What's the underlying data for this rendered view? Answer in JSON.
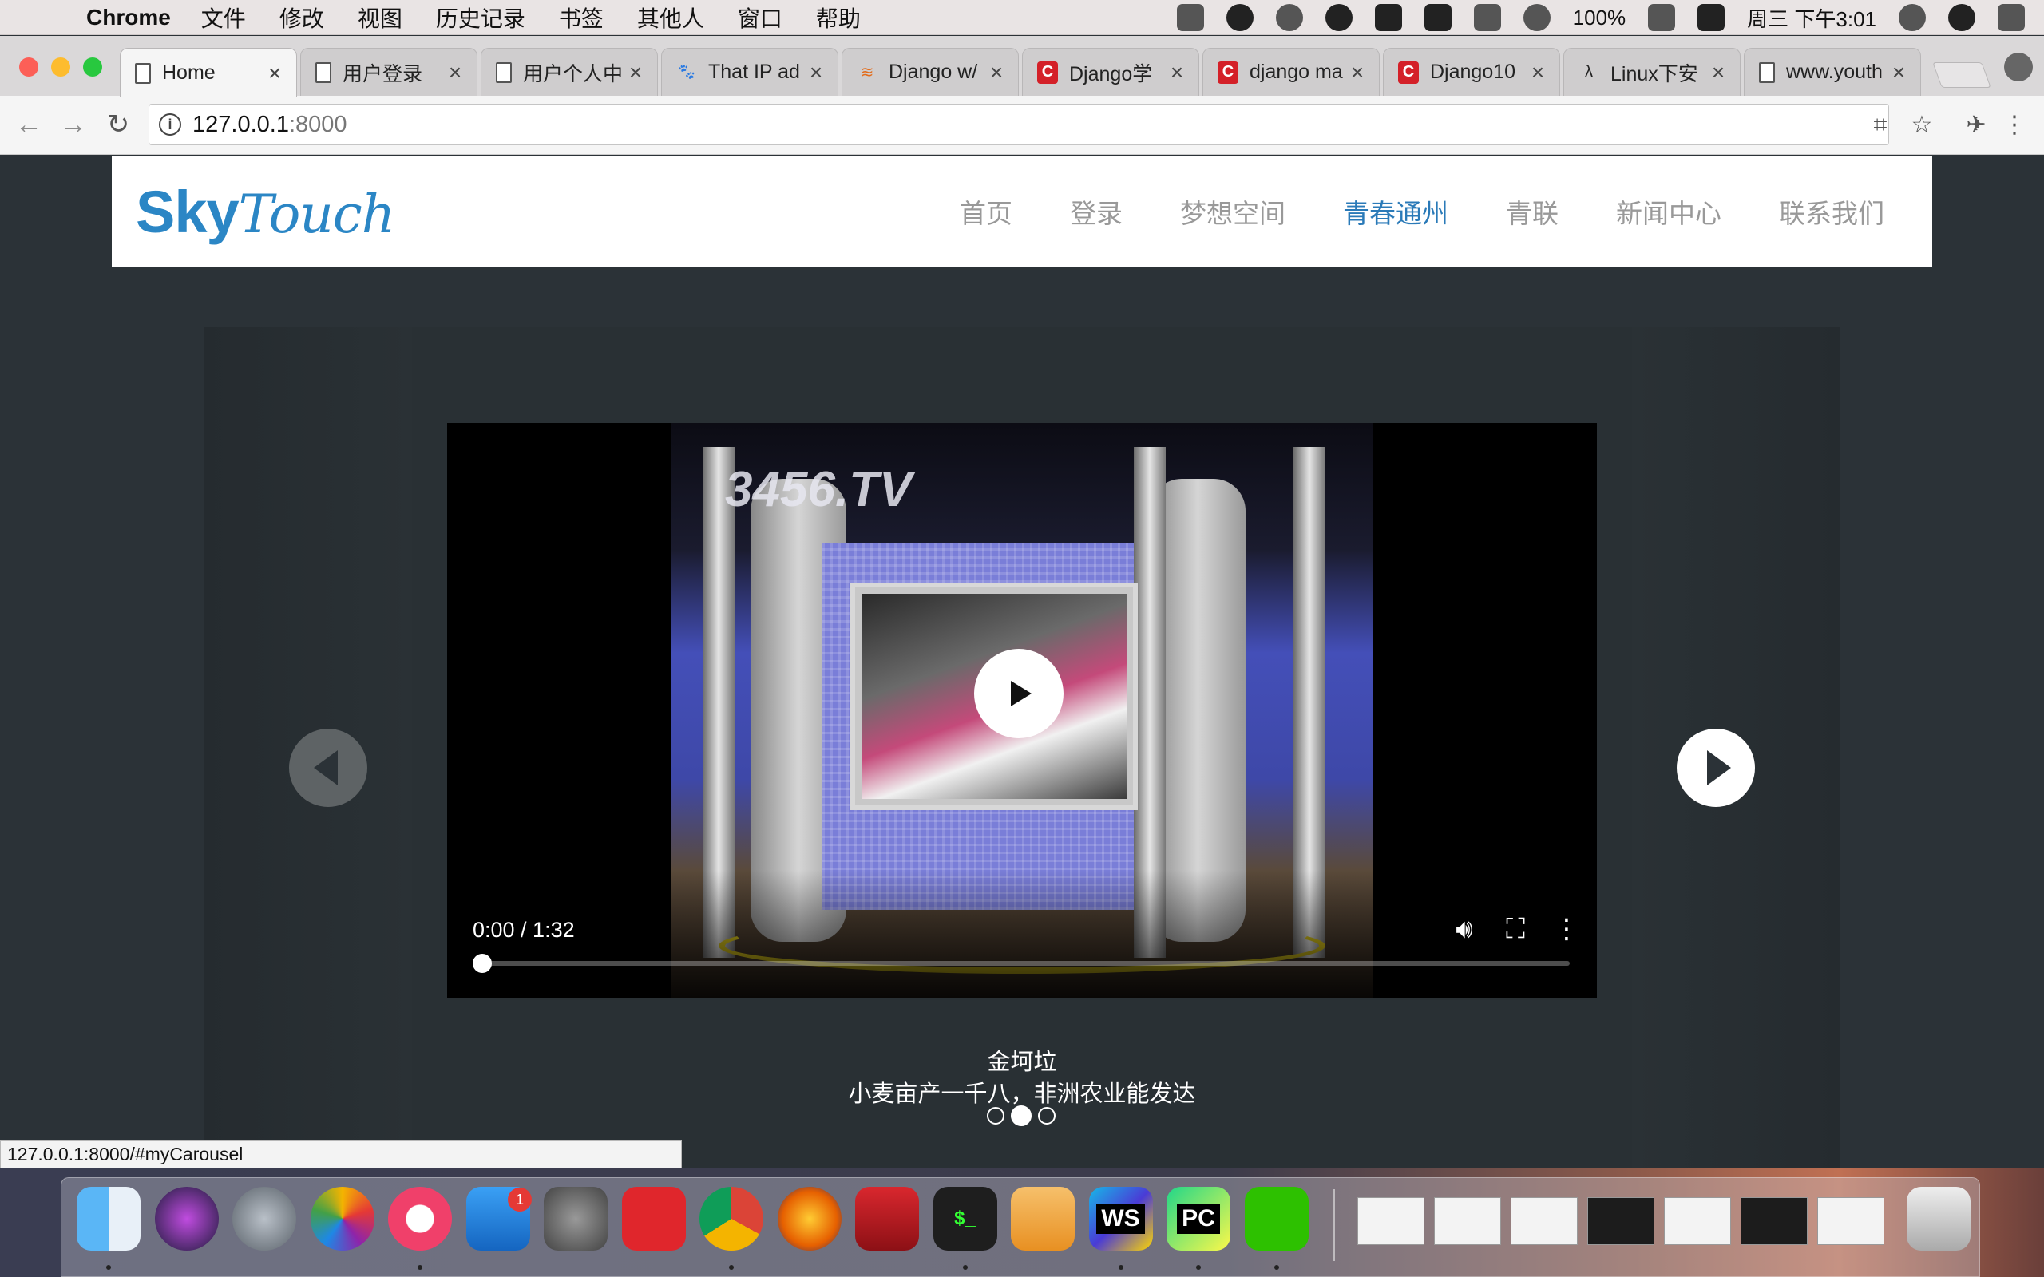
{
  "menubar": {
    "apple_glyph": "",
    "app": "Chrome",
    "items": [
      "文件",
      "修改",
      "视图",
      "历史记录",
      "书签",
      "其他人",
      "窗口",
      "帮助"
    ],
    "battery": "100%",
    "clock": "周三 下午3:01"
  },
  "tabs": [
    {
      "title": "Home",
      "icon": "document-icon",
      "active": true
    },
    {
      "title": "用户登录",
      "icon": "document-icon"
    },
    {
      "title": "用户个人中",
      "icon": "document-icon"
    },
    {
      "title": "That IP ad",
      "icon": "baidu-paw-icon"
    },
    {
      "title": "Django w/",
      "icon": "stackoverflow-icon"
    },
    {
      "title": "Django学",
      "icon": "csdn-icon"
    },
    {
      "title": "django ma",
      "icon": "csdn-icon"
    },
    {
      "title": "Django10",
      "icon": "csdn-icon"
    },
    {
      "title": "Linux下安",
      "icon": "linux-icon"
    },
    {
      "title": "www.youth",
      "icon": "document-icon"
    }
  ],
  "omnibox": {
    "host": "127.0.0.1",
    "port": ":8000"
  },
  "site": {
    "logo_sky": "Sky",
    "logo_touch": "Touch",
    "nav": [
      "首页",
      "登录",
      "梦想空间",
      "青春通州",
      "青联",
      "新闻中心",
      "联系我们"
    ],
    "nav_active_index": 3
  },
  "video": {
    "watermark": "3456.TV",
    "time": "0:00 / 1:32",
    "progress": 0.0
  },
  "carousel": {
    "caption_title": "金坷垃",
    "caption_sub": "小麦亩产一千八，非洲农业能发达",
    "slides": 3,
    "active_slide": 2
  },
  "status_url": "127.0.0.1:8000/#myCarousel",
  "dock": {
    "apps": [
      "finder",
      "siri",
      "launchpad",
      "photos",
      "itunes",
      "app-store",
      "system-preferences",
      "netease-music",
      "chrome",
      "firefox",
      "autocad",
      "terminal",
      "pages",
      "webstorm",
      "pycharm",
      "wechat"
    ],
    "app_store_badge": "1",
    "webstorm_label": "WS",
    "pycharm_label": "PC",
    "terminal_label": "$_"
  }
}
